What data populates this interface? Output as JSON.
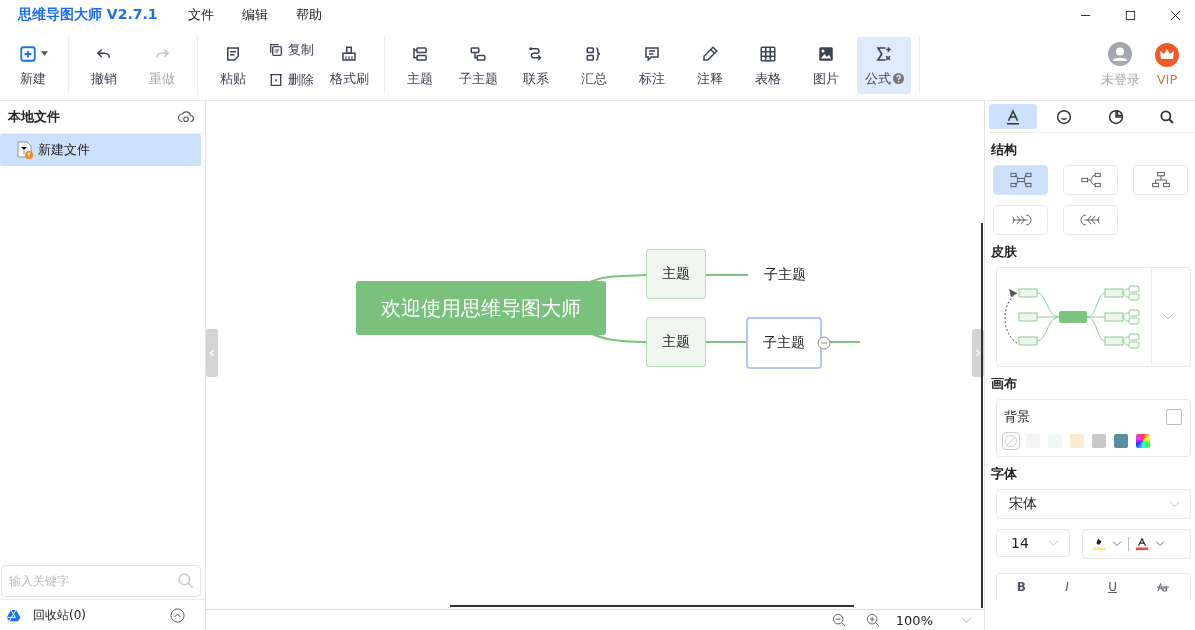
{
  "window": {
    "title": "思维导图大师 V2.7.1"
  },
  "menu": [
    "文件",
    "编辑",
    "帮助"
  ],
  "toolbar": {
    "groups": [
      {
        "items": [
          {
            "kind": "button",
            "label": "新建",
            "dropdown": true,
            "disabled": false,
            "selected": false
          }
        ]
      },
      {
        "items": [
          {
            "kind": "button",
            "label": "撤销",
            "disabled": false,
            "selected": false
          },
          {
            "kind": "button",
            "label": "重做",
            "disabled": true,
            "selected": false
          }
        ]
      },
      {
        "items": [
          {
            "kind": "button",
            "label": "粘贴",
            "disabled": false,
            "selected": false
          },
          {
            "kind": "stack",
            "items": [
              {
                "label": "复制",
                "disabled": false
              },
              {
                "label": "删除",
                "disabled": false
              }
            ]
          },
          {
            "kind": "button",
            "label": "格式刷",
            "disabled": false,
            "selected": false
          }
        ]
      },
      {
        "items": [
          {
            "kind": "button",
            "label": "主题",
            "disabled": false,
            "selected": false
          },
          {
            "kind": "button",
            "label": "子主题",
            "disabled": false,
            "selected": false
          },
          {
            "kind": "button",
            "label": "联系",
            "disabled": false,
            "selected": false
          },
          {
            "kind": "button",
            "label": "汇总",
            "disabled": false,
            "selected": false
          },
          {
            "kind": "button",
            "label": "标注",
            "disabled": false,
            "selected": false
          },
          {
            "kind": "button",
            "label": "注释",
            "disabled": false,
            "selected": false
          },
          {
            "kind": "button",
            "label": "表格",
            "disabled": false,
            "selected": false
          },
          {
            "kind": "button",
            "label": "图片",
            "disabled": false,
            "selected": false
          },
          {
            "kind": "button",
            "label": "公式",
            "help": true,
            "disabled": false,
            "selected": true
          }
        ]
      }
    ],
    "account": {
      "label": "未登录"
    },
    "vip": {
      "label": "VIP"
    }
  },
  "sidebar": {
    "title": "本地文件",
    "files": [
      {
        "name": "新建文件",
        "selected": true
      }
    ],
    "search": {
      "placeholder": "输入关键字"
    },
    "recycle": "回收站(0)"
  },
  "canvas": {
    "root": "欢迎使用思维导图大师",
    "topics": [
      {
        "label": "主题",
        "children": [
          {
            "label": "子主题",
            "selected": false
          }
        ]
      },
      {
        "label": "主题",
        "children": [
          {
            "label": "子主题",
            "selected": true,
            "collapsible": true
          }
        ]
      }
    ]
  },
  "status_bar": {
    "zoom": "100%"
  },
  "panel": {
    "tabs": [
      {
        "selected": true
      },
      {
        "selected": false
      },
      {
        "selected": false
      },
      {
        "selected": false
      }
    ],
    "structure": {
      "title": "结构",
      "options": [
        {
          "selected": true
        },
        {
          "selected": false
        },
        {
          "selected": false
        },
        {
          "selected": false
        },
        {
          "selected": false
        }
      ]
    },
    "skin": {
      "title": "皮肤"
    },
    "canvas": {
      "title": "画布",
      "background_label": "背景",
      "background_checked": false,
      "swatches": [
        {
          "kind": "none",
          "selected": true
        },
        {
          "kind": "color",
          "color": "#f3f4f6",
          "selected": false
        },
        {
          "kind": "color",
          "color": "#f0f7f7",
          "selected": false
        },
        {
          "kind": "color",
          "color": "#fdebd0",
          "selected": false
        },
        {
          "kind": "color",
          "color": "#c8c8c8",
          "selected": false
        },
        {
          "kind": "color",
          "color": "#5b8ea0",
          "selected": false
        },
        {
          "kind": "custom",
          "selected": false
        }
      ]
    },
    "font": {
      "title": "字体",
      "family": "宋体",
      "size": "14",
      "format": [
        "B",
        "I",
        "U"
      ]
    }
  }
}
